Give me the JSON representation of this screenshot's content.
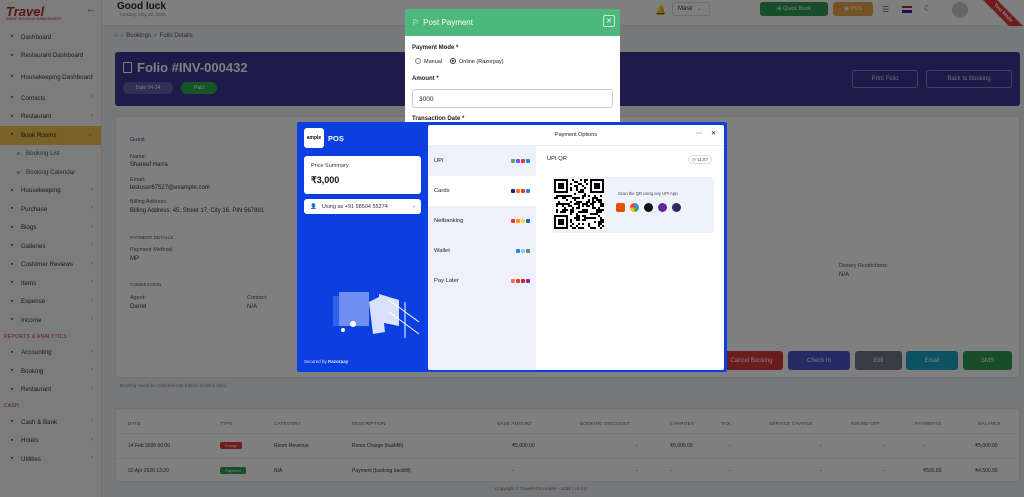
{
  "app": {
    "logo_text": "Travel",
    "logo_sub": "SMART BOOKING MANAGEMENT"
  },
  "sidebar": {
    "items": [
      {
        "label": "Dashboard",
        "icon": "dashboard-icon"
      },
      {
        "label": "Restaurant Dashboard",
        "icon": "dashboard-icon"
      },
      {
        "label": "Housekeeping Dashboard",
        "icon": "dashboard-icon"
      },
      {
        "label": "Contacts",
        "icon": "contacts-icon"
      },
      {
        "label": "Restaurant",
        "icon": "restaurant-icon"
      },
      {
        "label": "Book Rooms",
        "icon": "bed-icon"
      },
      {
        "label": "Booking List",
        "icon": "circle-icon"
      },
      {
        "label": "Booking Calendar",
        "icon": "circle-icon"
      },
      {
        "label": "Housekeeping",
        "icon": "broom-icon"
      },
      {
        "label": "Purchase",
        "icon": "cart-icon"
      },
      {
        "label": "Blogs",
        "icon": "blog-icon"
      },
      {
        "label": "Galleries",
        "icon": "gallery-icon"
      },
      {
        "label": "Customer Reviews",
        "icon": "star-icon"
      },
      {
        "label": "Items",
        "icon": "box-icon"
      },
      {
        "label": "Expense",
        "icon": "minus-circle-icon"
      },
      {
        "label": "Income",
        "icon": "plus-circle-icon"
      }
    ],
    "section_reports": "REPORTS & ANALYTICS",
    "reports": [
      {
        "label": "Accounting",
        "icon": "calculator-icon"
      },
      {
        "label": "Booking",
        "icon": "calendar-icon"
      },
      {
        "label": "Restaurant",
        "icon": "restaurant-icon"
      }
    ],
    "section_cash": "CASH",
    "cash": [
      {
        "label": "Cash & Bank",
        "icon": "bank-icon"
      },
      {
        "label": "Hotels",
        "icon": "hotel-icon"
      },
      {
        "label": "Utilities",
        "icon": "tools-icon"
      }
    ]
  },
  "header": {
    "greeting": "Good luck",
    "date": "Tuesday, May 20, 2026",
    "profile": "Mask",
    "quick_book": "Quick Book",
    "pos": "POS",
    "ribbon": "Test Mode"
  },
  "breadcrumb": {
    "items": [
      "Bookings",
      "Folio Details"
    ]
  },
  "folio": {
    "title": "Folio #INV-000432",
    "date_pill": "Date 04-14",
    "status_pill": "Paid",
    "print_label": "Print Folio",
    "back_label": "Back to Booking"
  },
  "guest": {
    "section": "Guest",
    "name_label": "Name:",
    "name": "Shareef Harra",
    "email_label": "Email:",
    "email": "testuser67527@example.com",
    "billing_label": "Billing Address:",
    "billing": "Billing Address: 45, Street 17, City 16, PIN 567891",
    "payment_section": "PAYMENT DETAILS",
    "payment_method_label": "Payment Method:",
    "payment_method": "MP",
    "commission_section": "COMMISSION",
    "agent_label": "Agent:",
    "agent": "Darrel",
    "contact_label": "Contact:",
    "contact": "N/A",
    "dietary_label": "Dietary Restrictions:",
    "dietary": "N/A"
  },
  "actions": {
    "cancel": "Cancel Booking",
    "checkin": "Check In",
    "edit": "Edit",
    "email": "Email",
    "sms": "SMS",
    "note": "Booking saved for Checked Out Edition (Adding folio)"
  },
  "table": {
    "headers": [
      "DATE",
      "TYPE",
      "CATEGORY",
      "DESCRIPTION",
      "BASE AMOUNT",
      "BOOKING DISCOUNT",
      "CHARGES",
      "TAX",
      "SERVICE CHARGE",
      "ROUND OFF",
      "PAYMENTS",
      "BALANCE"
    ],
    "rows": [
      {
        "date": "14 Feb 2026 00:00",
        "type": "Charge",
        "category": "Room Revenue",
        "description": "Room Charge (backfill)",
        "base": "₹5,000.00",
        "discount": "-",
        "charges": "₹5,000.00",
        "tax": "-",
        "service": "-",
        "round": "-",
        "payments": "-",
        "balance": "₹5,000.00"
      },
      {
        "date": "02 Apr 2026 13:20",
        "type": "Payment",
        "category": "N/A",
        "description": "Payment (booking backfill)",
        "base": "-",
        "discount": "-",
        "charges": "-",
        "tax": "-",
        "service": "-",
        "round": "-",
        "payments": "₹500.00",
        "balance": "₹4,500.00"
      }
    ]
  },
  "footer": "Copyright © TravelPOS Hotels – 2026 | v4.0.0",
  "post_payment": {
    "title": "Post Payment",
    "mode_label": "Payment Mode *",
    "mode_manual": "Manual",
    "mode_online": "Online (Razorpay)",
    "amount_label": "Amount *",
    "amount_value": "3000",
    "txn_label": "Transaction Date *"
  },
  "razorpay": {
    "merchant": "POS",
    "merchant_logo": "ample",
    "price_summary_label": "Price Summary",
    "price": "₹3,000",
    "using_as": "Using as +91 98504 55274",
    "secured_by": "Secured by",
    "brand": "Razorpay",
    "options_title": "Payment Options",
    "methods": [
      "UPI",
      "Cards",
      "Netbanking",
      "Wallet",
      "Pay Later"
    ],
    "upi_qr_title": "UPI QR",
    "timer": "11:57",
    "scan_text": "Scan the QR using any UPI App"
  },
  "colors": {
    "accent": "#3a3794",
    "razorpay": "#0b3fe0",
    "post_green": "#4cb87c",
    "active": "#f3c44a"
  }
}
